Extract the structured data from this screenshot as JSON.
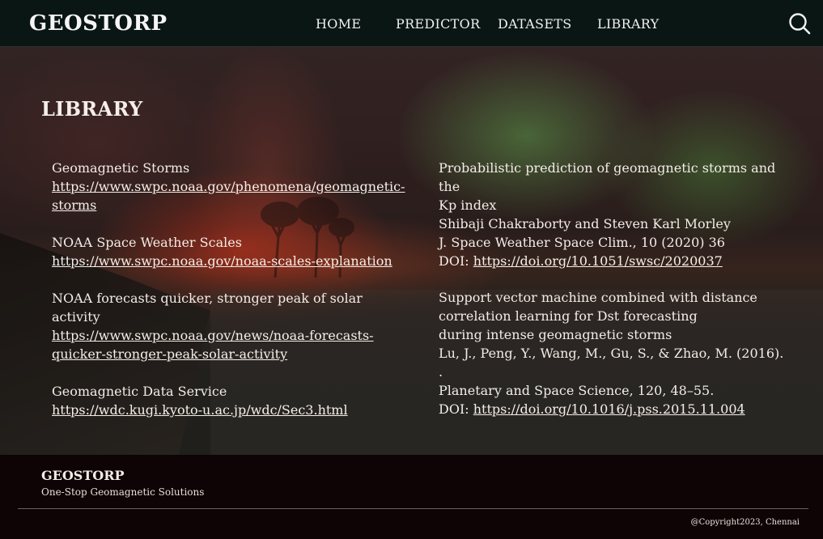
{
  "header": {
    "logo": "GEOSTORP",
    "nav": {
      "home": "HOME",
      "predictor": "PREDICTOR",
      "datasets": "DATASETS",
      "library": "LIBRARY"
    },
    "search_icon": "search-icon"
  },
  "library": {
    "title": "LIBRARY",
    "left": [
      {
        "title": "Geomagnetic Storms",
        "url_lines": [
          "https://www.swpc.noaa.gov/phenomena/geomagnetic-",
          "storms"
        ]
      },
      {
        "title": "NOAA Space Weather Scales",
        "url_lines": [
          "https://www.swpc.noaa.gov/noaa-scales-explanation"
        ]
      },
      {
        "title": "NOAA forecasts quicker, stronger peak of solar activity",
        "url_lines": [
          "https://www.swpc.noaa.gov/news/noaa-forecasts-",
          "quicker-stronger-peak-solar-activity"
        ]
      },
      {
        "title": "Geomagnetic Data Service",
        "url_lines": [
          "https://wdc.kugi.kyoto-u.ac.jp/wdc/Sec3.html"
        ]
      }
    ],
    "right": [
      {
        "title_lines": [
          "Probabilistic prediction of geomagnetic storms and the",
          "Kp index"
        ],
        "authors": "Shibaji Chakraborty and Steven Karl Morley",
        "journal": "J. Space Weather Space Clim., 10 (2020) 36",
        "doi_label": "DOI: ",
        "doi": "https://doi.org/10.1051/swsc/2020037"
      },
      {
        "title_lines": [
          "Support vector machine combined with distance",
          "correlation learning for Dst forecasting",
          "during intense geomagnetic storms"
        ],
        "authors": "Lu, J., Peng, Y., Wang, M., Gu, S., & Zhao, M. (2016). .",
        "journal": "Planetary and Space Science, 120, 48–55.",
        "doi_label": "DOI: ",
        "doi": "https://doi.org/10.1016/j.pss.2015.11.004"
      }
    ]
  },
  "footer": {
    "brand": "GEOSTORP",
    "tagline": "One-Stop Geomagnetic Solutions",
    "copyright": "@Copyright2023, Chennai"
  },
  "colors": {
    "nav_bg": "#0a1613",
    "footer_bg": "#0e0405",
    "text": "#f3ece6"
  }
}
